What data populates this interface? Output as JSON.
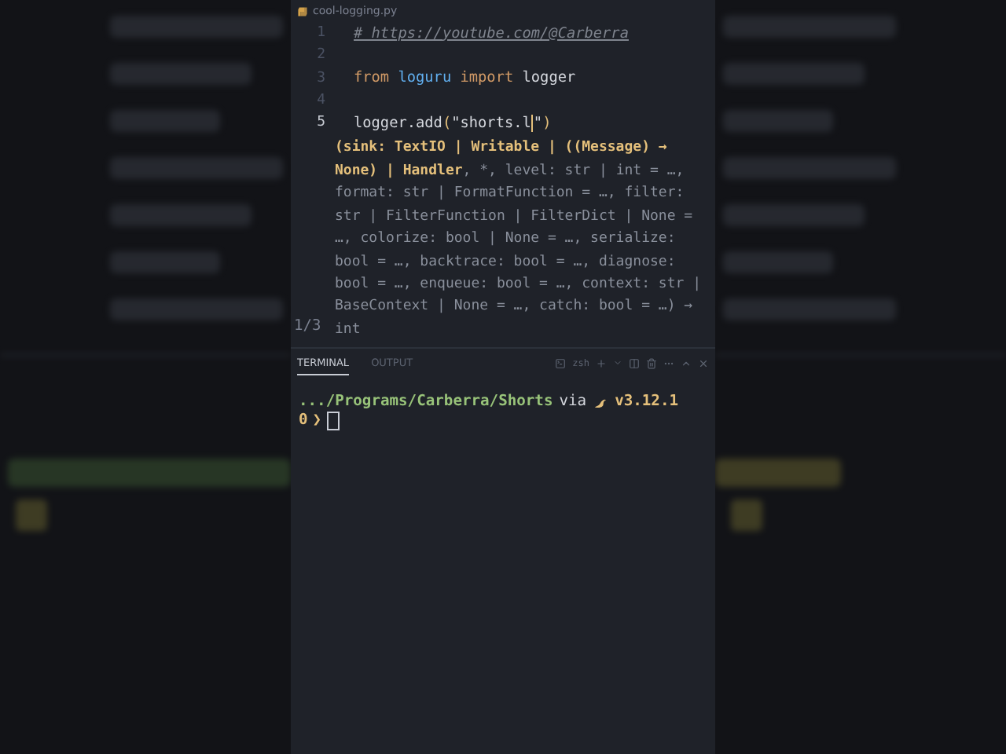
{
  "editor": {
    "tab": {
      "filename": "cool-logging.py"
    },
    "lines": [
      {
        "number": "1",
        "tokens": [
          {
            "kind": "comment",
            "text": "# https://youtube.com/@Carberra"
          }
        ]
      },
      {
        "number": "2"
      },
      {
        "number": "3",
        "tokens": [
          {
            "kind": "keyword",
            "text": "from "
          },
          {
            "kind": "module",
            "text": "loguru "
          },
          {
            "kind": "keyword",
            "text": "import "
          },
          {
            "kind": "plain",
            "text": "logger"
          }
        ]
      },
      {
        "number": "4"
      },
      {
        "number": "5",
        "tokens": [
          {
            "kind": "plain",
            "text": "logger.add"
          },
          {
            "kind": "bracket",
            "text": "("
          },
          {
            "kind": "string",
            "text": "\"shorts.l"
          },
          {
            "kind": "cursor"
          },
          {
            "kind": "string",
            "text": "\""
          },
          {
            "kind": "bracket",
            "text": ")"
          }
        ]
      }
    ],
    "hover": {
      "params_highlighted": "(sink: TextIO | Writable | ((Message) → None) | Handler",
      "params_rest": ", *, level: str | int = …, format: str | FormatFunction = …, filter: str | FilterFunction | FilterDict | None = …, colorize: bool | None = …, serialize: bool = …, backtrace: bool = …, diagnose: bool = …, enqueue: bool = …, context: str | BaseContext | None = …, catch: bool = …) → int",
      "overload": "1/3"
    }
  },
  "panel": {
    "tabs": [
      {
        "label": "TERMINAL",
        "selected": true
      },
      {
        "label": "OUTPUT",
        "selected": false
      }
    ],
    "shell": "zsh"
  },
  "terminal": {
    "path": ".../Programs/Carberra/Shorts",
    "via": "via",
    "version": "v3.12.1",
    "exit_code": "0",
    "prompt": "❯"
  }
}
